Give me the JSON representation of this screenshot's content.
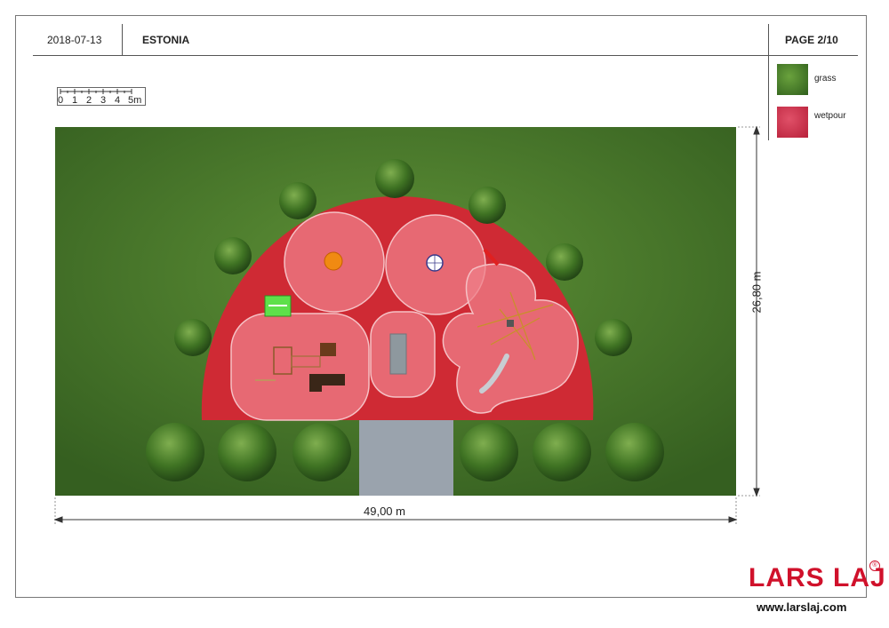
{
  "header": {
    "date": "2018-07-13",
    "country": "ESTONIA",
    "page": "PAGE 2/10"
  },
  "legend": [
    {
      "label": "grass",
      "color": "#4f8a2f"
    },
    {
      "label": "wetpour",
      "color": "#d23a4e"
    }
  ],
  "scale_bar": {
    "ticks": [
      "0",
      "1",
      "2",
      "3",
      "4",
      "5m"
    ]
  },
  "dimensions": {
    "width": "49,00 m",
    "height": "26,80 m"
  },
  "colors": {
    "grass": "#4a7a2a",
    "wetpour": "#cf2a34",
    "path": "#9aa3ad",
    "brand": "#d0112b"
  },
  "brand": {
    "logo": "LARS LAJ",
    "registered": "®",
    "url": "www.larslaj.com"
  }
}
